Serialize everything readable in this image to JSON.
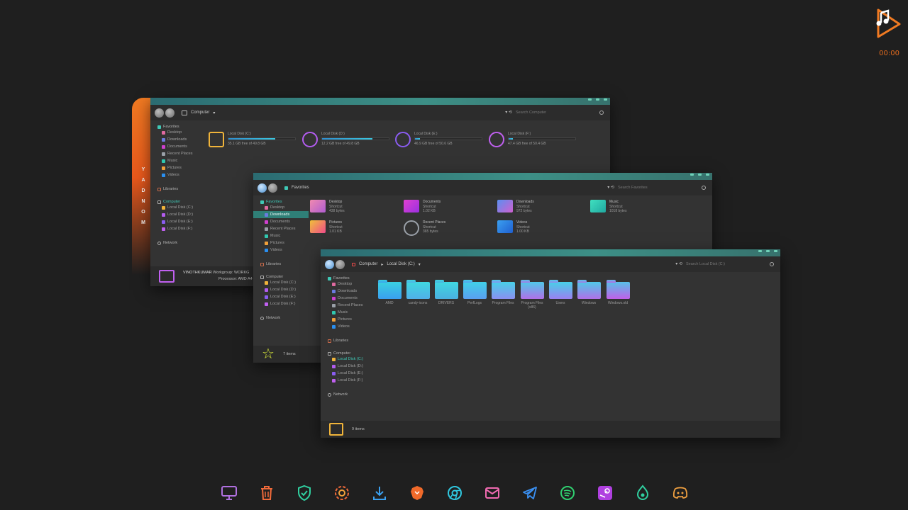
{
  "clock": "00:00",
  "day_letters": [
    "Y",
    "A",
    "D",
    "N",
    "O",
    "M"
  ],
  "win1": {
    "breadcrumb": "Computer",
    "search_placeholder": "Search Computer",
    "sidebar": {
      "favorites": "Favorites",
      "favorites_items": [
        "Desktop",
        "Downloads",
        "Documents",
        "Recent Places",
        "Music",
        "Pictures",
        "Videos"
      ],
      "libraries": "Libraries",
      "computer": "Computer",
      "computer_items": [
        "Local Disk (C:)",
        "Local Disk (D:)",
        "Local Disk (E:)",
        "Local Disk (F:)"
      ],
      "network": "Network"
    },
    "drives": [
      {
        "name": "Local Disk (C:)",
        "info": "35.1 GB free of 49.8 GB",
        "used": 0.3,
        "color": "#f0b43a"
      },
      {
        "name": "Local Disk (D:)",
        "info": "12.2 GB free of 49.8 GB",
        "used": 0.75,
        "color": "#b35cf0"
      },
      {
        "name": "Local Disk (E:)",
        "info": "46.9 GB free of 50.6 GB",
        "used": 0.07,
        "color": "#8a5cf0"
      },
      {
        "name": "Local Disk (F:)",
        "info": "47.4 GB free of 50.4 GB",
        "used": 0.06,
        "color": "#c060f0"
      }
    ],
    "footer": {
      "computer_name": "VINOTHKUMAR",
      "workgroup": "Workgroup: WORKG",
      "processor": "Processor: AMD A4"
    }
  },
  "win2": {
    "breadcrumb": "Favorites",
    "search_placeholder": "Search Favorites",
    "sidebar": {
      "favorites": "Favorites",
      "favorites_items": [
        "Desktop",
        "Downloads",
        "Documents",
        "Recent Places",
        "Music",
        "Pictures",
        "Videos"
      ],
      "libraries": "Libraries",
      "computer": "Computer",
      "computer_items": [
        "Local Disk (C:)",
        "Local Disk (D:)",
        "Local Disk (E:)",
        "Local Disk (F:)"
      ],
      "network": "Network"
    },
    "items": [
      {
        "name": "Desktop",
        "type": "Shortcut",
        "size": "438 bytes",
        "color": "#e06aa0"
      },
      {
        "name": "Documents",
        "type": "Shortcut",
        "size": "1.02 KB",
        "color": "#d040d0"
      },
      {
        "name": "Downloads",
        "type": "Shortcut",
        "size": "972 bytes",
        "color": "#6a7be0"
      },
      {
        "name": "Music",
        "type": "Shortcut",
        "size": "1018 bytes",
        "color": "#30c8b0"
      },
      {
        "name": "Pictures",
        "type": "Shortcut",
        "size": "1.01 KB",
        "color": "#f0a03a"
      },
      {
        "name": "Recent Places",
        "type": "Shortcut",
        "size": "365 bytes",
        "color": "#9aa0a8"
      },
      {
        "name": "Videos",
        "type": "Shortcut",
        "size": "1.00 KB",
        "color": "#2a8ff0"
      }
    ],
    "footer": "7 items"
  },
  "win3": {
    "breadcrumb": [
      "Computer",
      "Local Disk (C:)"
    ],
    "search_placeholder": "Search Local Disk (C:)",
    "sidebar": {
      "favorites": "Favorites",
      "favorites_items": [
        "Desktop",
        "Downloads",
        "Documents",
        "Recent Places",
        "Music",
        "Pictures",
        "Videos"
      ],
      "libraries": "Libraries",
      "computer": "Computer",
      "computer_items": [
        "Local Disk (C:)",
        "Local Disk (D:)",
        "Local Disk (E:)",
        "Local Disk (F:)"
      ],
      "network": "Network"
    },
    "folders": [
      "AMD",
      "candy-icons",
      "DRIVERS",
      "PerfLogs",
      "Program Files",
      "Program Files (x86)",
      "Users",
      "Windows",
      "Windows.old"
    ],
    "footer": "9 items"
  },
  "dock": [
    "monitor-icon",
    "trash-icon",
    "shield-icon",
    "settings-icon",
    "download-icon",
    "brave-icon",
    "chrome-icon",
    "mail-icon",
    "telegram-icon",
    "spotify-icon",
    "steam-icon",
    "drop-icon",
    "discord-icon"
  ],
  "colors": {
    "accent": "#e8581c",
    "teal": "#3d8f86"
  }
}
